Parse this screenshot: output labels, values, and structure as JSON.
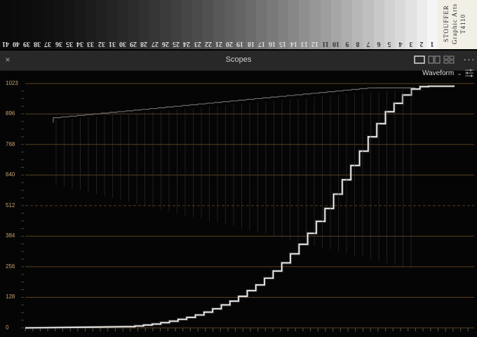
{
  "stepwedge": {
    "steps": [
      "41",
      "40",
      "39",
      "38",
      "37",
      "36",
      "35",
      "34",
      "33",
      "32",
      "31",
      "30",
      "29",
      "28",
      "27",
      "26",
      "25",
      "24",
      "23",
      "22",
      "21",
      "20",
      "19",
      "18",
      "17",
      "16",
      "15",
      "14",
      "13",
      "12",
      "11",
      "10",
      "9",
      "8",
      "7",
      "6",
      "5",
      "4",
      "3",
      "2",
      "1"
    ],
    "label_lines": [
      "STOUFFER",
      "Graphic Arts",
      "T4110"
    ]
  },
  "panel": {
    "title": "Scopes",
    "close_glyph": "×",
    "more_glyph": "···",
    "layout_icons": [
      "single-view-icon",
      "dual-view-icon",
      "quad-view-icon"
    ]
  },
  "scope": {
    "type_label": "Waveform",
    "chevron": "⌄",
    "trace_color": "#ffffff",
    "grid_color": "#5a3e20",
    "label_color": "#c8a070",
    "y_axis": {
      "min": 0,
      "max": 1023,
      "ticks": [
        {
          "label": "1023",
          "value": 1023
        },
        {
          "label": "896",
          "value": 896
        },
        {
          "label": "768",
          "value": 768
        },
        {
          "label": "640",
          "value": 640
        },
        {
          "label": "512",
          "value": 512
        },
        {
          "label": "384",
          "value": 384
        },
        {
          "label": "256",
          "value": 256
        },
        {
          "label": "128",
          "value": 128
        },
        {
          "label": "0",
          "value": 0
        }
      ],
      "dashed_value": 512
    },
    "steps_levels": [
      5,
      8,
      12,
      16,
      22,
      28,
      36,
      44,
      54,
      66,
      80,
      96,
      112,
      132,
      156,
      180,
      208,
      238,
      272,
      310,
      350,
      396,
      446,
      500,
      560,
      620,
      680,
      740,
      800,
      855,
      905,
      940,
      975,
      1000,
      1010,
      1012,
      1012,
      1012
    ]
  }
}
